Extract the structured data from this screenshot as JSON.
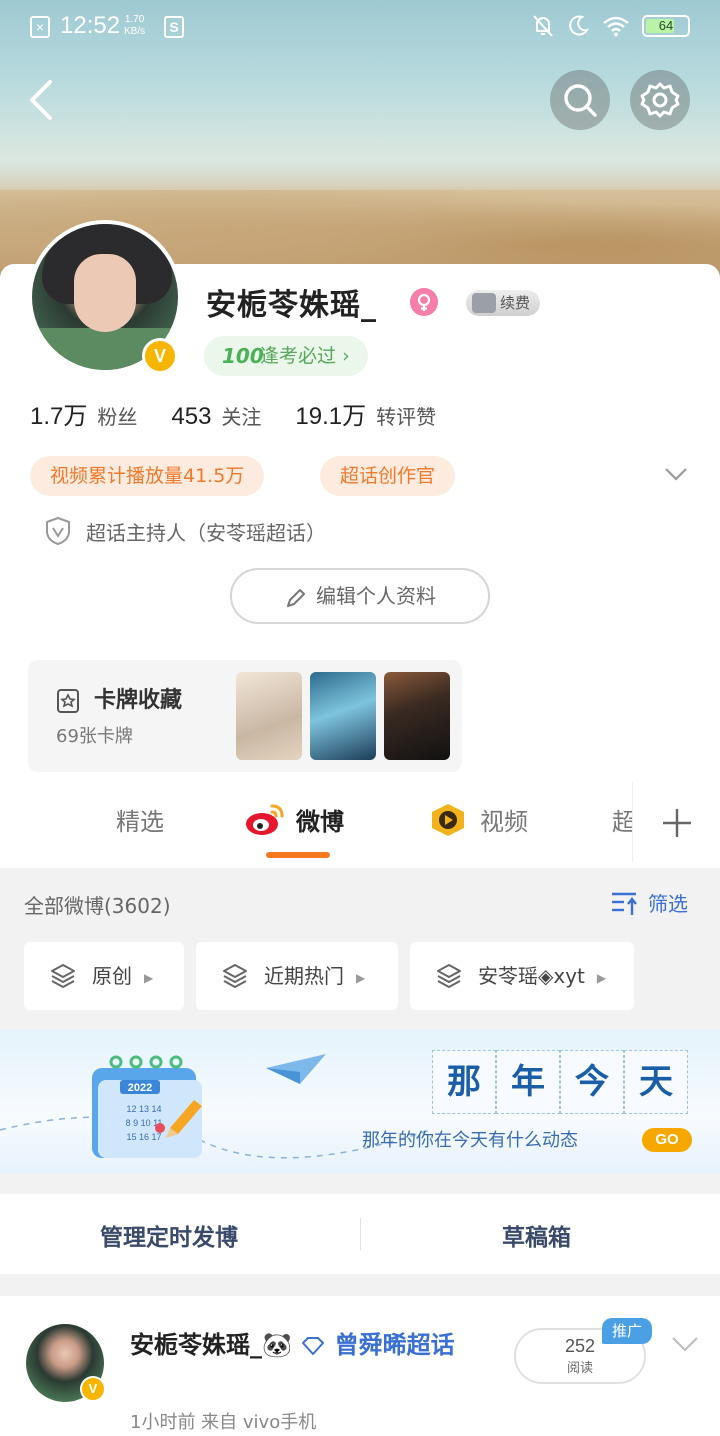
{
  "status_bar": {
    "time": "12:52",
    "speed": "1.70",
    "speed_unit": "KB/s",
    "battery": "64"
  },
  "profile": {
    "username": "安栀苓姝瑶_",
    "vip_label": "续费",
    "exam_label": "逢考必过",
    "exam_icon_text": "100",
    "stats": [
      {
        "value": "1.7万",
        "label": "粉丝"
      },
      {
        "value": "453",
        "label": "关注"
      },
      {
        "value": "19.1万",
        "label": "转评赞"
      }
    ],
    "tags": [
      "视频累计播放量41.5万",
      "超话创作官"
    ],
    "host_label": "超话主持人（安苓瑶超话）",
    "edit_label": "编辑个人资料",
    "verified_mark": "V"
  },
  "card_collection": {
    "title": "卡牌收藏",
    "subtitle": "69张卡牌"
  },
  "tabs": [
    {
      "label": "精选"
    },
    {
      "label": "微博"
    },
    {
      "label": "视频"
    },
    {
      "label": "超话"
    }
  ],
  "feed": {
    "all_posts": "全部微博(3602)",
    "filter_label": "筛选",
    "chips": [
      "原创",
      "近期热门",
      "安苓瑶◈xyt"
    ]
  },
  "memory_banner": {
    "chars": [
      "那",
      "年",
      "今",
      "天"
    ],
    "subtitle": "那年的你在今天有什么动态",
    "go": "GO",
    "calendar_year": "2022",
    "calendar_days": "12 13 14\n8 9 10 11\n15 16 17"
  },
  "manage": {
    "left": "管理定时发博",
    "right": "草稿箱"
  },
  "post": {
    "author": "安栀苓姝瑶_🐼",
    "topic": "曾舜晞超话",
    "meta": "1小时前  来自 vivo手机",
    "reads": "252",
    "reads_label": "阅读",
    "promo": "推广",
    "verified_mark": "V"
  },
  "colors": {
    "accent_orange": "#f5791f",
    "link_blue": "#3a6fd4",
    "tag_orange": "#f07a2a",
    "verified_gold": "#f7b500"
  }
}
